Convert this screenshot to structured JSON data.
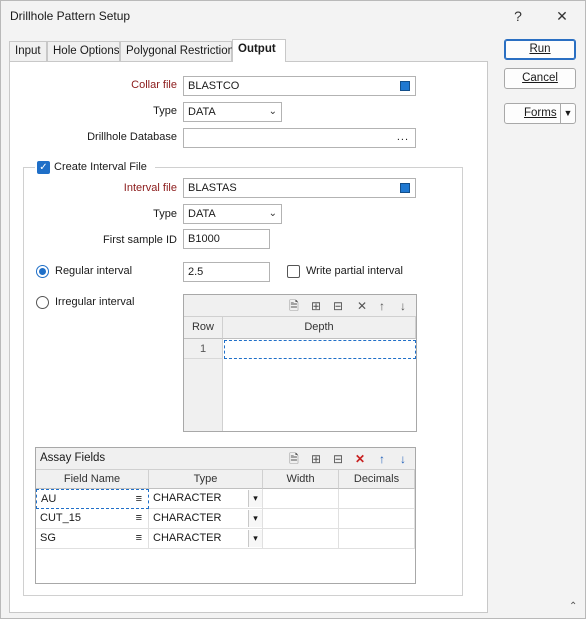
{
  "window": {
    "title": "Drillhole Pattern Setup",
    "help_glyph": "?",
    "close_glyph": "✕"
  },
  "tabs": [
    {
      "label": "Input"
    },
    {
      "label": "Hole Options"
    },
    {
      "label": "Polygonal Restriction"
    },
    {
      "label": "Output"
    }
  ],
  "collar": {
    "file_label": "Collar file",
    "file_value": "BLASTCO",
    "type_label": "Type",
    "type_value": "DATA",
    "db_label": "Drillhole Database",
    "db_value": "",
    "browse_glyph": "..."
  },
  "interval": {
    "create_label": "Create Interval File",
    "create_checked": true,
    "file_label": "Interval file",
    "file_value": "BLASTAS",
    "type_label": "Type",
    "type_value": "DATA",
    "first_sample_label": "First sample ID",
    "first_sample_value": "B1000",
    "regular_label": "Regular interval",
    "regular_value": "2.5",
    "write_partial_label": "Write partial interval",
    "irregular_label": "Irregular interval"
  },
  "depth_grid": {
    "col_row": "Row",
    "col_depth": "Depth",
    "rows": [
      {
        "row": "1",
        "depth": ""
      }
    ]
  },
  "assay": {
    "title": "Assay Fields",
    "columns": [
      "Field Name",
      "Type",
      "Width",
      "Decimals"
    ],
    "rows": [
      {
        "name": "AU",
        "type": "CHARACTER",
        "width": "",
        "decimals": ""
      },
      {
        "name": "CUT_15",
        "type": "CHARACTER",
        "width": "",
        "decimals": ""
      },
      {
        "name": "SG",
        "type": "CHARACTER",
        "width": "",
        "decimals": ""
      }
    ],
    "list_glyph": "≡",
    "dropdown_glyph": "▾"
  },
  "buttons": {
    "run": "Run",
    "cancel": "Cancel",
    "forms": "Forms"
  },
  "icons": {
    "new": "new-document-icon",
    "insert_row": "insert-row-icon",
    "append_row": "append-row-icon",
    "delete": "delete-icon",
    "move_up": "arrow-up-icon",
    "move_down": "arrow-down-icon"
  },
  "colors": {
    "accent": "#1f6fc8",
    "required_label": "#8b1a1a",
    "delete_red": "#c82020"
  }
}
